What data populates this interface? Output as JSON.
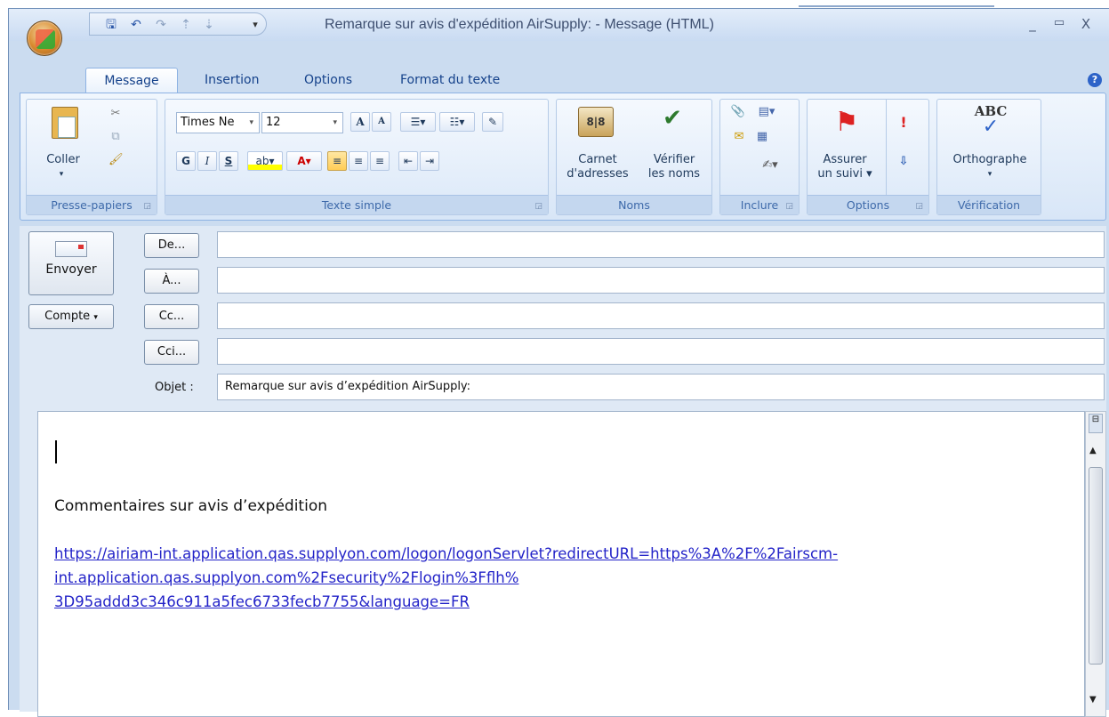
{
  "window": {
    "title": "Remarque sur avis d'expédition AirSupply: - Message (HTML)",
    "min": "_",
    "max": "▭",
    "close": "X"
  },
  "tabs": [
    {
      "label": "Message"
    },
    {
      "label": "Insertion"
    },
    {
      "label": "Options"
    },
    {
      "label": "Format du texte"
    }
  ],
  "ribbon": {
    "groups": {
      "clipboard": "Presse-papiers",
      "basic_text": "Texte simple",
      "names": "Noms",
      "include": "Inclure",
      "options": "Options",
      "proofing": "Vérification"
    },
    "paste": "Coller",
    "font_name": "Times Ne",
    "font_size": "12",
    "address_book_1": "Carnet",
    "address_book_2": "d'adresses",
    "check_names_1": "Vérifier",
    "check_names_2": "les noms",
    "followup_1": "Assurer",
    "followup_2": "un suivi",
    "spelling": "Orthographe",
    "abc": "ABC"
  },
  "header": {
    "send": "Envoyer",
    "account": "Compte",
    "from": "De...",
    "to": "À...",
    "cc": "Cc...",
    "bcc": "Cci...",
    "subject_label": "Objet :",
    "subject_value": "Remarque sur avis d’expédition AirSupply:"
  },
  "body": {
    "line1": "Commentaires sur avis d’expédition",
    "link_l1": "https://airiam-int.application.qas.supplyon.com/logon/logonServlet?redirectURL=https%3A%2F%2Fairscm-",
    "link_l2": "int.application.qas.supplyon.com%2Fsecurity%2Flogin%3Fflh%",
    "link_l3": "3D95addd3c346c911a5fec6733fecb7755&language=FR"
  }
}
